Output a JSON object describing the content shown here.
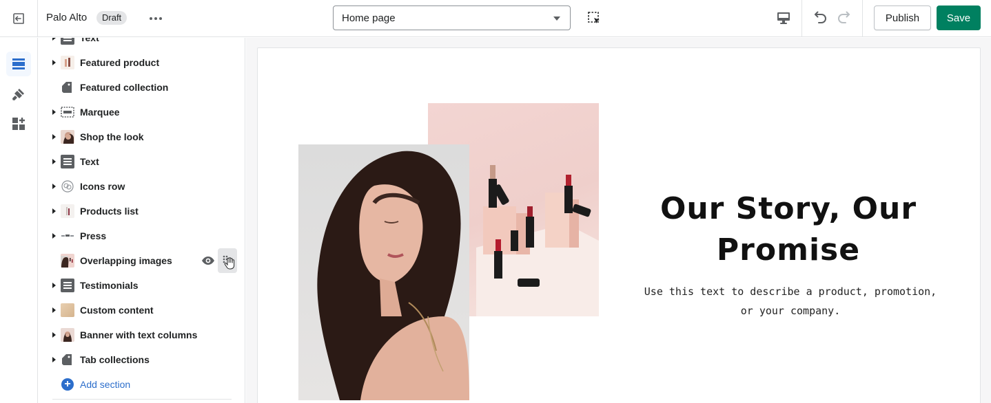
{
  "topbar": {
    "store_name": "Palo Alto",
    "status_badge": "Draft",
    "page_selector": "Home page",
    "publish_label": "Publish",
    "save_label": "Save"
  },
  "colors": {
    "accent_green": "#008060",
    "link_blue": "#2c6ecb",
    "rail_active": "#2c6ecb"
  },
  "rail": [
    {
      "icon": "sections-icon",
      "active": true
    },
    {
      "icon": "theme-settings-brush-icon",
      "active": false
    },
    {
      "icon": "apps-icon",
      "active": false
    }
  ],
  "sidebar": {
    "items": [
      {
        "label": "Text",
        "icon": "text-icon",
        "expandable": true
      },
      {
        "label": "Featured product",
        "icon": "featured-product-thumb",
        "expandable": true
      },
      {
        "label": "Featured collection",
        "icon": "collection-tag-icon",
        "expandable": false
      },
      {
        "label": "Marquee",
        "icon": "marquee-icon",
        "expandable": true
      },
      {
        "label": "Shop the look",
        "icon": "shop-the-look-thumb",
        "expandable": true
      },
      {
        "label": "Text",
        "icon": "text-icon",
        "expandable": true
      },
      {
        "label": "Icons row",
        "icon": "icons-row-thumb",
        "expandable": true
      },
      {
        "label": "Products list",
        "icon": "products-list-thumb",
        "expandable": true
      },
      {
        "label": "Press",
        "icon": "press-thumb",
        "expandable": true
      },
      {
        "label": "Overlapping images",
        "icon": "overlapping-images-thumb",
        "expandable": false,
        "hovered": true
      },
      {
        "label": "Testimonials",
        "icon": "text-icon",
        "expandable": true
      },
      {
        "label": "Custom content",
        "icon": "custom-content-thumb",
        "expandable": true
      },
      {
        "label": "Banner with text columns",
        "icon": "banner-thumb",
        "expandable": true
      },
      {
        "label": "Tab collections",
        "icon": "collection-tag-icon",
        "expandable": true
      }
    ],
    "add_section_label": "Add section"
  },
  "preview": {
    "heading": "Our Story, Our Promise",
    "body": "Use this text to describe a product, promotion, or your company."
  }
}
